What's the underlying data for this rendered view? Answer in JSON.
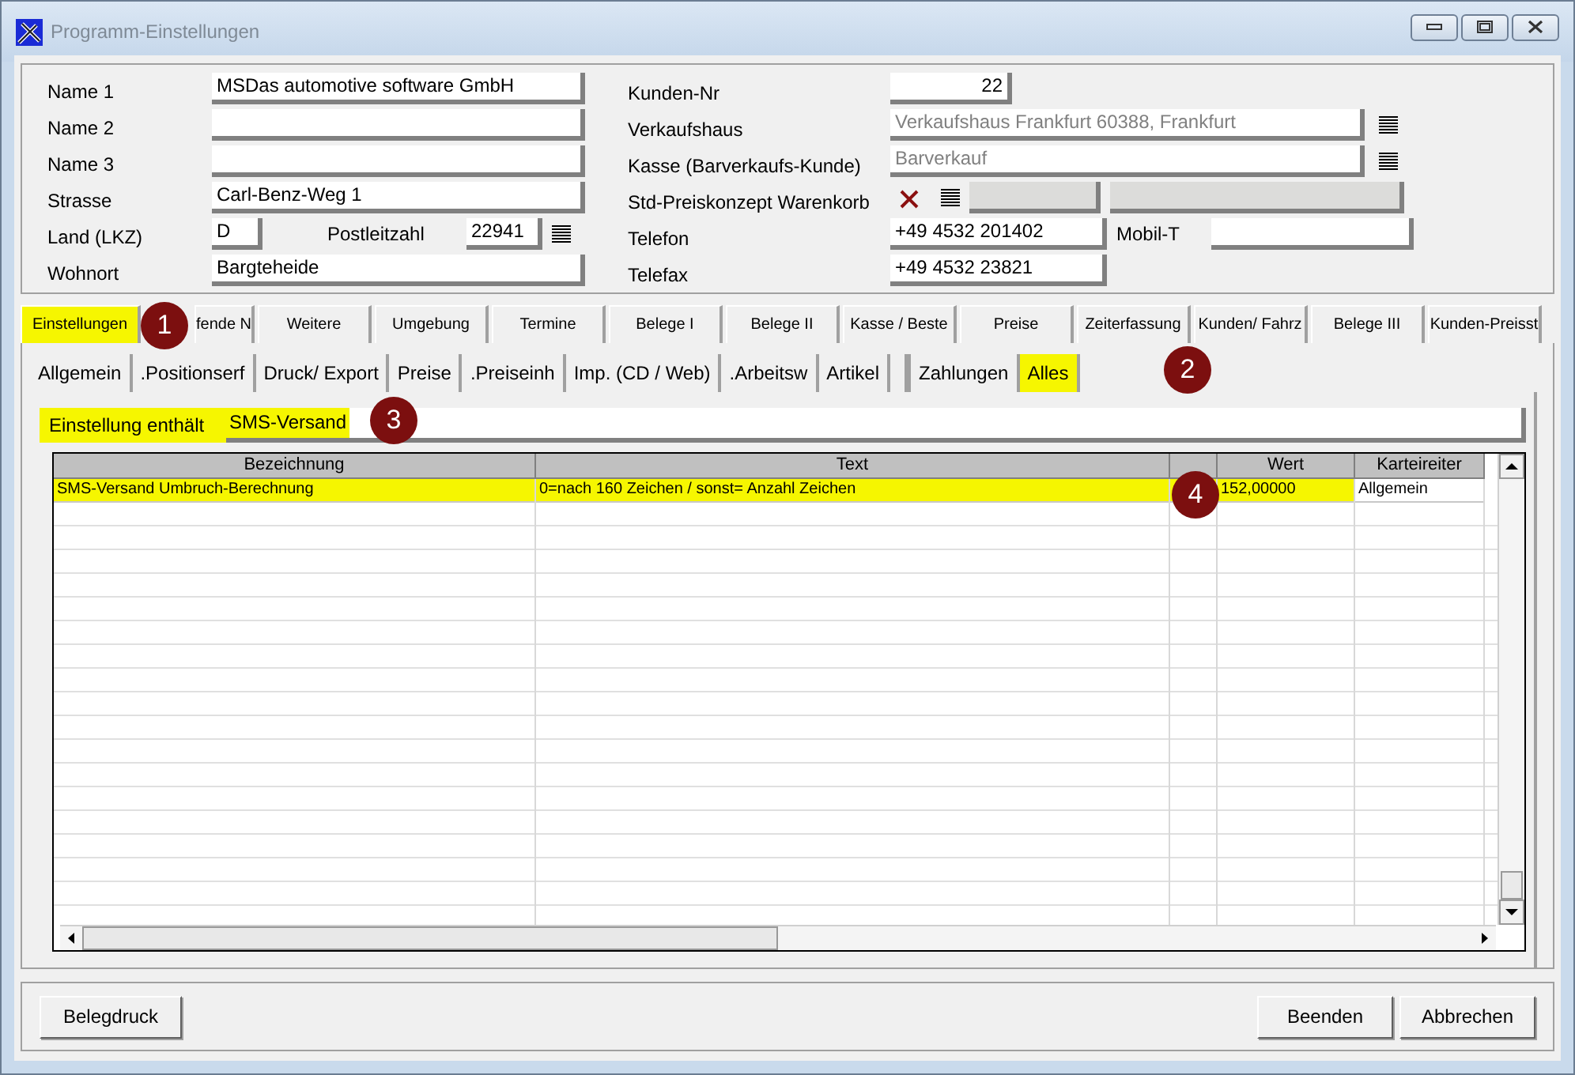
{
  "window": {
    "title": "Programm-Einstellungen"
  },
  "left_fields": [
    {
      "label": "Name 1",
      "value": "MSDas automotive software GmbH"
    },
    {
      "label": "Name 2"
    },
    {
      "label": "Name 3"
    },
    {
      "label": "Strasse",
      "value": "Carl-Benz-Weg 1"
    },
    {
      "kind": "land",
      "label": "Land (LKZ)",
      "value": "D",
      "label2": "Postleitzahl",
      "value2": "22941"
    },
    {
      "label": "Wohnort",
      "value": "Bargteheide"
    }
  ],
  "right_fields": [
    {
      "kind": "number",
      "label": "Kunden-Nr",
      "value": "22"
    },
    {
      "kind": "lookup",
      "label": "Verkaufshaus",
      "value": "Verkaufshaus Frankfurt 60388, Frankfurt",
      "readonly": true
    },
    {
      "kind": "lookup",
      "label": "Kasse (Barverkaufs-Kunde)",
      "value": "Barverkauf",
      "readonly": true
    },
    {
      "kind": "concept",
      "label": "Std-Preiskonzept Warenkorb",
      "disabled": true
    },
    {
      "kind": "phone",
      "label": "Telefon",
      "value": "+49 4532 201402",
      "label2": "Mobil-T"
    },
    {
      "kind": "short",
      "label": "Telefax",
      "value": "+49 4532 23821"
    }
  ],
  "tabs": [
    {
      "label": "Einstellungen",
      "selected": true
    },
    {
      "label": "fende N",
      "selected": false
    },
    {
      "label": "Weitere",
      "selected": false
    },
    {
      "label": "Umgebung",
      "selected": false
    },
    {
      "label": "Termine",
      "selected": false
    },
    {
      "label": "Belege I",
      "selected": false
    },
    {
      "label": "Belege II",
      "selected": false
    },
    {
      "label": "Kasse / Beste",
      "selected": false
    },
    {
      "label": "Preise",
      "selected": false
    },
    {
      "label": "Zeiterfassung",
      "selected": false
    },
    {
      "label": "Kunden/ Fahrz",
      "selected": false
    },
    {
      "label": "Belege III",
      "selected": false
    },
    {
      "label": "Kunden-Preisst",
      "selected": false
    }
  ],
  "subtabs": [
    {
      "label": "Allgemein",
      "selected": false
    },
    {
      "label": ".Positionserf",
      "selected": false
    },
    {
      "label": "Druck/ Export",
      "selected": false
    },
    {
      "label": "Preise",
      "selected": false
    },
    {
      "label": ".Preiseinh",
      "selected": false
    },
    {
      "label": "Imp. (CD / Web)",
      "selected": false
    },
    {
      "label": ".Arbeitsw",
      "selected": false
    },
    {
      "label": "Artikel",
      "selected": false
    },
    {
      "selected": false
    },
    {
      "label": "Zahlungen",
      "selected": false
    },
    {
      "label": "Alles",
      "selected": true
    }
  ],
  "filter": {
    "label": "Einstellung enthält",
    "value": "SMS-Versand"
  },
  "table": {
    "columns": [
      {
        "label": "Bezeichnung"
      },
      {
        "label": "Text"
      },
      {},
      {
        "label": "Wert"
      },
      {
        "label": "Karteireiter"
      }
    ],
    "rows": [
      {
        "cells": [
          "SMS-Versand Umbruch-Berechnung",
          "0=nach 160 Zeichen / sonst= Anzahl Zeichen",
          "",
          "152,00000",
          "Allgemein"
        ],
        "selected": true
      }
    ]
  },
  "markers": [
    "1",
    "2",
    "3",
    "4"
  ],
  "buttons_left": [
    "Belegdruck"
  ],
  "buttons_right": [
    "Beenden",
    "Abbrechen"
  ]
}
